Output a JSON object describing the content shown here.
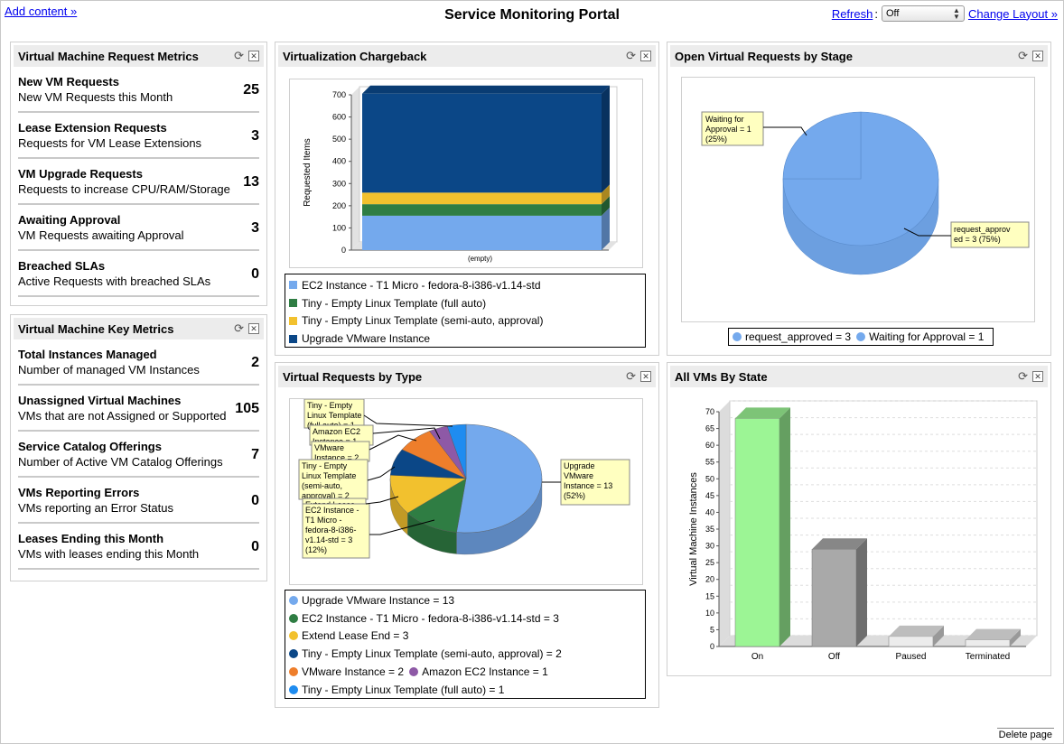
{
  "header": {
    "add_content": "Add content »",
    "title": "Service Monitoring Portal",
    "refresh_label": "Refresh",
    "refresh_value": "Off",
    "change_layout": "Change Layout »"
  },
  "panels": {
    "vm_request_metrics": {
      "title": "Virtual Machine Request Metrics",
      "items": [
        {
          "name": "New VM Requests",
          "desc": "New VM Requests this Month",
          "value": "25"
        },
        {
          "name": "Lease Extension Requests",
          "desc": "Requests for VM Lease Extensions",
          "value": "3"
        },
        {
          "name": "VM Upgrade Requests",
          "desc": "Requests to increase CPU/RAM/Storage",
          "value": "13"
        },
        {
          "name": "Awaiting Approval",
          "desc": "VM Requests awaiting Approval",
          "value": "3"
        },
        {
          "name": "Breached SLAs",
          "desc": "Active Requests with breached SLAs",
          "value": "0"
        }
      ]
    },
    "vm_key_metrics": {
      "title": "Virtual Machine Key Metrics",
      "items": [
        {
          "name": "Total Instances Managed",
          "desc": "Number of managed VM Instances",
          "value": "2"
        },
        {
          "name": "Unassigned Virtual Machines",
          "desc": "VMs that are not Assigned or Supported",
          "value": "105"
        },
        {
          "name": "Service Catalog Offerings",
          "desc": "Number of Active VM Catalog Offerings",
          "value": "7"
        },
        {
          "name": "VMs Reporting Errors",
          "desc": "VMs reporting an Error Status",
          "value": "0"
        },
        {
          "name": "Leases Ending this Month",
          "desc": "VMs with leases ending this Month",
          "value": "0"
        }
      ]
    },
    "chargeback": {
      "title": "Virtualization Chargeback"
    },
    "by_stage": {
      "title": "Open Virtual Requests by Stage"
    },
    "by_type": {
      "title": "Virtual Requests by Type"
    },
    "by_state": {
      "title": "All VMs By State"
    }
  },
  "chart_data": [
    {
      "id": "chargeback",
      "type": "bar",
      "stacked": true,
      "ylabel": "Requested Items",
      "xlabel": "",
      "categories": [
        "(empty)"
      ],
      "ylim": [
        0,
        700
      ],
      "yticks": [
        0,
        100,
        200,
        300,
        400,
        500,
        600,
        700
      ],
      "series": [
        {
          "name": "EC2 Instance - T1 Micro - fedora-8-i386-v1.14-std",
          "values": [
            155
          ],
          "color": "#74a9ed"
        },
        {
          "name": "Tiny - Empty Linux Template (full auto)",
          "values": [
            52
          ],
          "color": "#2f7d43"
        },
        {
          "name": "Tiny - Empty Linux Template (semi-auto, approval)",
          "values": [
            52
          ],
          "color": "#f2c12e"
        },
        {
          "name": "Upgrade VMware Instance",
          "values": [
            446
          ],
          "color": "#0b4787"
        }
      ]
    },
    {
      "id": "by_stage",
      "type": "pie",
      "slices": [
        {
          "name": "request_approved",
          "value": 3,
          "percent": "75%",
          "label": "request_approved = 3 (75%)",
          "legend": "request_approved = 3",
          "color": "#74a9ed"
        },
        {
          "name": "Waiting for Approval",
          "value": 1,
          "percent": "25%",
          "label": "Waiting for Approval = 1 (25%)",
          "legend": "Waiting for Approval = 1",
          "color": "#74a9ed"
        }
      ],
      "label_lines": {
        "request_approved": [
          "request_approv",
          "ed = 3 (75%)"
        ],
        "waiting": [
          "Waiting for",
          "Approval = 1",
          "(25%)"
        ]
      }
    },
    {
      "id": "by_type",
      "type": "pie",
      "slices": [
        {
          "name": "Upgrade VMware Instance",
          "value": 13,
          "legend": "Upgrade VMware Instance = 13",
          "color": "#74a9ed"
        },
        {
          "name": "EC2 Instance - T1 Micro - fedora-8-i386-v1.14-std",
          "value": 3,
          "legend": "EC2 Instance - T1 Micro - fedora-8-i386-v1.14-std = 3",
          "color": "#2f7d43"
        },
        {
          "name": "Extend Lease End",
          "value": 3,
          "legend": "Extend Lease End = 3",
          "color": "#f2c12e"
        },
        {
          "name": "Tiny - Empty Linux Template (semi-auto, approval)",
          "value": 2,
          "legend": "Tiny - Empty Linux Template (semi-auto, approval) = 2",
          "color": "#0b4787"
        },
        {
          "name": "VMware Instance",
          "value": 2,
          "legend": "VMware Instance = 2",
          "color": "#ee7e2b"
        },
        {
          "name": "Amazon EC2 Instance",
          "value": 1,
          "legend": "Amazon EC2 Instance = 1",
          "color": "#8e59a6"
        },
        {
          "name": "Tiny - Empty Linux Template (full auto)",
          "value": 1,
          "legend": "Tiny - Empty Linux Template (full auto) = 1",
          "color": "#1f8cf0"
        }
      ],
      "callouts": {
        "upgrade": [
          "Upgrade",
          "VMware",
          "Instance = 13",
          "(52%)"
        ],
        "tiny_full": [
          "Tiny - Empty",
          "Linux Template",
          "(full auto) = 1"
        ],
        "amazon": [
          "Amazon EC2",
          "Instance = 1"
        ],
        "vmware": [
          "VMware",
          "Instance = 2"
        ],
        "tiny_semi": [
          "Tiny - Empty",
          "Linux Template",
          "(semi-auto,",
          "approval) = 2"
        ],
        "extend": [
          "Extend Lease"
        ],
        "ec2": [
          "EC2 Instance -",
          "T1 Micro -",
          "fedora-8-i386-",
          "v1.14-std = 3",
          "(12%)"
        ]
      }
    },
    {
      "id": "by_state",
      "type": "bar",
      "ylabel": "Virtual Machine Instances",
      "xlabel": "",
      "categories": [
        "On",
        "Off",
        "Paused",
        "Terminated"
      ],
      "values": [
        68,
        29,
        3,
        2
      ],
      "colors": [
        "#9cf595",
        "#a9a9a9",
        "#ececec",
        "#ececec"
      ],
      "ylim": [
        0,
        70
      ],
      "yticks": [
        0,
        5,
        10,
        15,
        20,
        25,
        30,
        35,
        40,
        45,
        50,
        55,
        60,
        65,
        70
      ]
    }
  ],
  "footer": {
    "delete_page": "Delete page"
  },
  "icons": {
    "refresh": "refresh-icon",
    "close": "close-icon"
  }
}
